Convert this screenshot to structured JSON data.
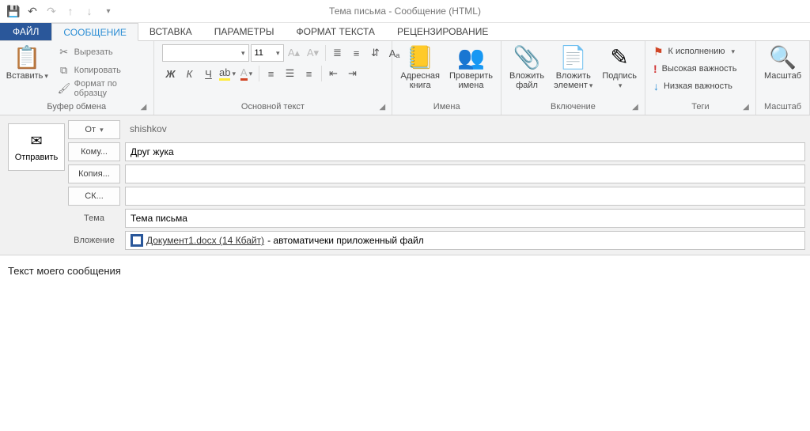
{
  "window": {
    "title": "Тема письма - Сообщение (HTML)"
  },
  "tabs": {
    "file": "ФАЙЛ",
    "message": "СООБЩЕНИЕ",
    "insert": "ВСТАВКА",
    "options": "ПАРАМЕТРЫ",
    "format": "ФОРМАТ ТЕКСТА",
    "review": "РЕЦЕНЗИРОВАНИЕ"
  },
  "ribbon": {
    "clipboard": {
      "label": "Буфер обмена",
      "paste": "Вставить",
      "cut": "Вырезать",
      "copy": "Копировать",
      "format_painter": "Формат по образцу"
    },
    "basic_text": {
      "label": "Основной текст",
      "font_size": "11"
    },
    "names": {
      "label": "Имена",
      "address_book": "Адресная\nкнига",
      "check_names": "Проверить\nимена"
    },
    "include": {
      "label": "Включение",
      "attach_file": "Вложить\nфайл",
      "attach_item": "Вложить\nэлемент",
      "signature": "Подпись"
    },
    "tags": {
      "label": "Теги",
      "follow_up": "К исполнению",
      "high_importance": "Высокая важность",
      "low_importance": "Низкая важность"
    },
    "zoom": {
      "label": "Масштаб",
      "zoom": "Масштаб"
    }
  },
  "header": {
    "send": "Отправить",
    "from_btn": "От",
    "from_value": "shishkov",
    "to_btn": "Кому...",
    "to_value": "Друг жука",
    "cc_btn": "Копия...",
    "cc_value": "",
    "bcc_btn": "СК...",
    "bcc_value": "",
    "subject_label": "Тема",
    "subject_value": "Тема письма",
    "attach_label": "Вложение",
    "attach_name": "Документ1.docx (14 Кбайт)",
    "attach_note": " - автоматичеки приложенный файл"
  },
  "body": {
    "text": "Текст моего сообщения"
  }
}
